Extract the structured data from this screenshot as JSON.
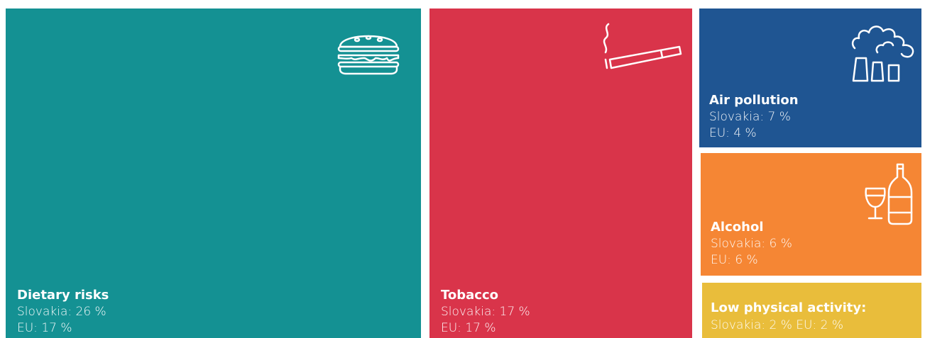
{
  "chart_data": {
    "type": "treemap",
    "categories": [
      "Dietary risks",
      "Tobacco",
      "Air pollution",
      "Alcohol",
      "Low physical activity:"
    ],
    "series": [
      {
        "name": "Slovakia",
        "values": [
          26,
          17,
          7,
          6,
          2
        ]
      },
      {
        "name": "EU",
        "values": [
          17,
          17,
          4,
          6,
          2
        ]
      }
    ],
    "items": [
      {
        "name": "Dietary risks",
        "slovakia": "Slovakia: 26 %",
        "eu": "EU: 17 %",
        "color": "#149193",
        "icon": "burger-icon"
      },
      {
        "name": "Tobacco",
        "slovakia": "Slovakia: 17 %",
        "eu": "EU: 17 %",
        "color": "#d9344a",
        "icon": "cigarette-icon"
      },
      {
        "name": "Air pollution",
        "slovakia": "Slovakia: 7 %",
        "eu": "EU: 4 %",
        "color": "#1f5592",
        "icon": "factory-smoke-icon"
      },
      {
        "name": "Alcohol",
        "slovakia": "Slovakia: 6 %",
        "eu": "EU: 6 %",
        "color": "#f58634",
        "icon": "wine-bottle-icon"
      },
      {
        "name": "Low physical activity:",
        "slovakia": "Slovakia: 2 %",
        "eu": "EU: 2 %",
        "color": "#e9bd3b",
        "icon": ""
      }
    ]
  }
}
